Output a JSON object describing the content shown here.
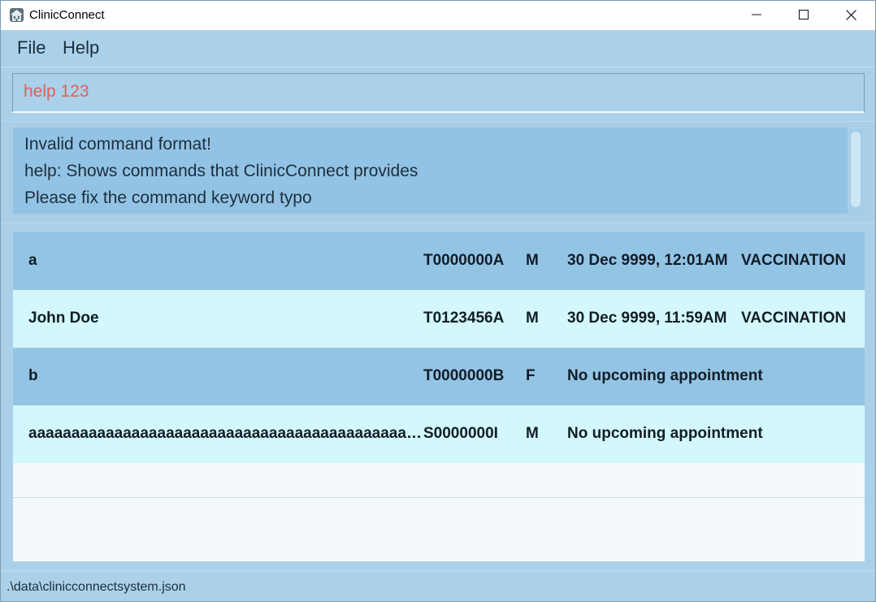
{
  "window": {
    "title": "ClinicConnect",
    "app_icon": "clinic-building-icon",
    "controls": {
      "minimize_icon": "minimize-icon",
      "maximize_icon": "maximize-icon",
      "close_icon": "close-icon"
    }
  },
  "menu": {
    "file_label": "File",
    "help_label": "Help"
  },
  "command": {
    "value": "help 123"
  },
  "result": {
    "lines": [
      "Invalid command format!",
      "help: Shows commands that ClinicConnect provides",
      "Please fix the command keyword typo"
    ]
  },
  "patients": [
    {
      "name": "a",
      "nric": "T0000000A",
      "sex": "M",
      "appointment": "30 Dec 9999, 12:01AM",
      "type": "VACCINATION"
    },
    {
      "name": "John Doe",
      "nric": "T0123456A",
      "sex": "M",
      "appointment": "30 Dec 9999, 11:59AM",
      "type": "VACCINATION"
    },
    {
      "name": "b",
      "nric": "T0000000B",
      "sex": "F",
      "appointment": "No upcoming appointment",
      "type": ""
    },
    {
      "name": "aaaaaaaaaaaaaaaaaaaaaaaaaaaaaaaaaaaaaaaaaaaaaaaaaaaaaaaaaaaaaaaaaaaaaaaaaaaaaaaaaaaa",
      "nric": "S0000000I",
      "sex": "M",
      "appointment": "No upcoming appointment",
      "type": ""
    }
  ],
  "status": {
    "file_path": ".\\data\\clinicconnectsystem.json"
  },
  "colors": {
    "background": "#aad1e9",
    "result_box": "#92c3e4",
    "row_dark": "#94c4e4",
    "row_light": "#d3f8fc",
    "command_text": "#d9635a"
  }
}
